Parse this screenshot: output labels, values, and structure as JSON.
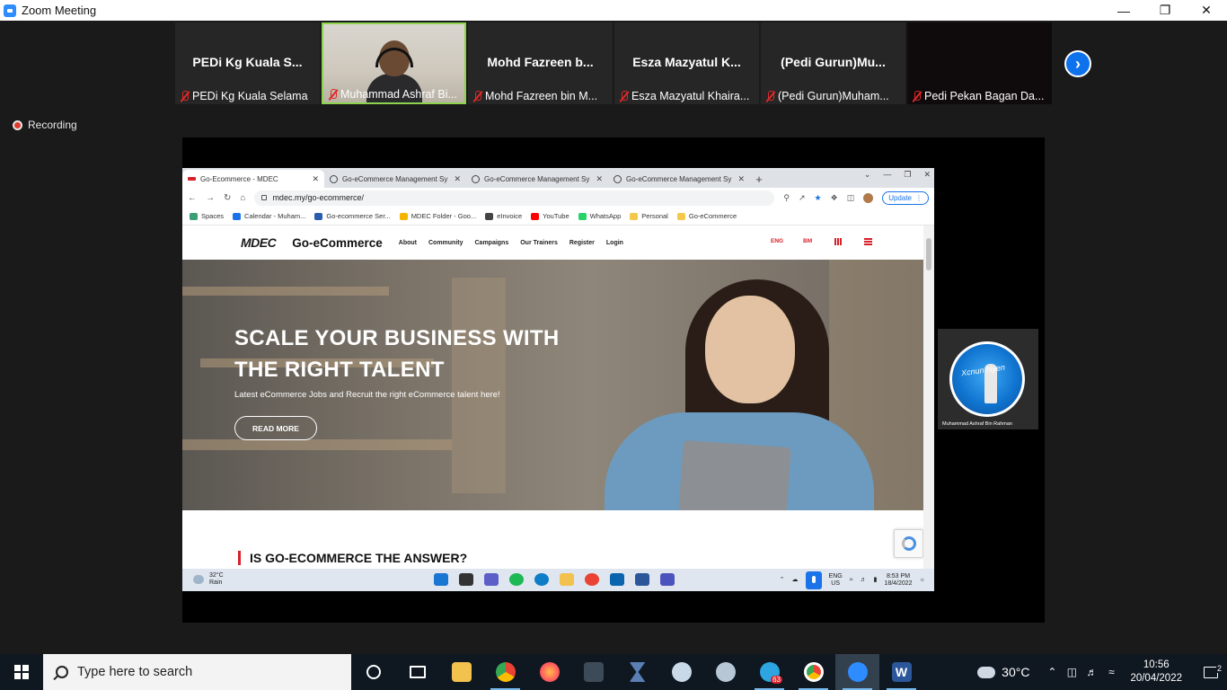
{
  "window": {
    "title": "Zoom Meeting"
  },
  "participants": [
    {
      "display": "PEDi Kg Kuala S...",
      "label": "PEDi Kg Kuala Selama",
      "video": false
    },
    {
      "display": "",
      "label": "Muhammad Ashraf Bi...",
      "video": true
    },
    {
      "display": "Mohd Fazreen b...",
      "label": "Mohd Fazreen bin M...",
      "video": false
    },
    {
      "display": "Esza Mazyatul K...",
      "label": "Esza Mazyatul Khaira...",
      "video": false
    },
    {
      "display": "(Pedi Gurun)Mu...",
      "label": "(Pedi Gurun)Muham...",
      "video": false
    },
    {
      "display": "",
      "label": "Pedi Pekan Bagan Da...",
      "video": false
    }
  ],
  "recording": {
    "label": "Recording"
  },
  "browser": {
    "tabs": [
      {
        "label": "Go-Ecommerce - MDEC",
        "active": true
      },
      {
        "label": "Go-eCommerce Management Sy",
        "active": false
      },
      {
        "label": "Go-eCommerce Management Sy",
        "active": false
      },
      {
        "label": "Go-eCommerce Management Sy",
        "active": false
      }
    ],
    "url": "mdec.my/go-ecommerce/",
    "update_label": "Update",
    "bookmarks": [
      {
        "label": "Spaces",
        "color": "#3a9f74"
      },
      {
        "label": "Calendar - Muham...",
        "color": "#1a73e8"
      },
      {
        "label": "Go-ecommerce Ser...",
        "color": "#2a5db0"
      },
      {
        "label": "MDEC Folder - Goo...",
        "color": "#f4b400"
      },
      {
        "label": "eInvoice",
        "color": "#444444"
      },
      {
        "label": "YouTube",
        "color": "#ff0000"
      },
      {
        "label": "WhatsApp",
        "color": "#25d366"
      },
      {
        "label": "Personal",
        "color": "#f3c84b"
      },
      {
        "label": "Go-eCommerce",
        "color": "#f3c84b"
      }
    ]
  },
  "website": {
    "logo": "MDEC",
    "brand": "Go-eCommerce",
    "nav": [
      "About",
      "Community",
      "Campaigns",
      "Our Trainers",
      "Register",
      "Login"
    ],
    "lang_eng": "ENG",
    "lang_bm": "BM",
    "hero_title_line1": "SCALE YOUR BUSINESS WITH",
    "hero_title_line2": "THE RIGHT TALENT",
    "hero_subtitle": "Latest eCommerce Jobs and Recruit the right eCommerce talent here!",
    "read_more": "READ MORE",
    "section_title": "IS GO-ECOMMERCE THE ANSWER?"
  },
  "inner_taskbar": {
    "temp": "32°C",
    "condition": "Rain",
    "lang1": "ENG",
    "lang2": "US",
    "time": "8:53 PM",
    "date": "18/4/2022"
  },
  "self_view": {
    "name": "Muhammad Ashraf Bin Rahman",
    "overlay_text": "Xcnun Nyen"
  },
  "taskbar": {
    "search_placeholder": "Type here to search",
    "temperature": "30°C",
    "time": "10:56",
    "date": "20/04/2022",
    "notifications": "2",
    "badge_count": "63"
  },
  "colors": {
    "zoom_blue": "#0e72ed",
    "mdec_red": "#d6202a",
    "active_speaker": "#8dd34d"
  }
}
